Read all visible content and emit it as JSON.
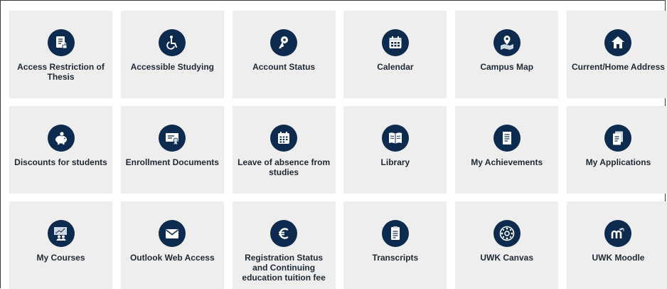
{
  "tiles": [
    {
      "label": "Access Restriction of Thesis",
      "icon": "document-lock-icon"
    },
    {
      "label": "Accessible Studying",
      "icon": "wheelchair-icon"
    },
    {
      "label": "Account Status",
      "icon": "key-icon"
    },
    {
      "label": "Calendar",
      "icon": "calendar-icon"
    },
    {
      "label": "Campus Map",
      "icon": "map-pin-icon"
    },
    {
      "label": "Current/Home Address",
      "icon": "home-icon"
    },
    {
      "label": "Discounts for students",
      "icon": "piggy-bank-icon"
    },
    {
      "label": "Enrollment Documents",
      "icon": "certificate-icon"
    },
    {
      "label": "Leave of absence from studies",
      "icon": "calendar-grid-icon"
    },
    {
      "label": "Library",
      "icon": "book-icon"
    },
    {
      "label": "My Achievements",
      "icon": "document-list-icon"
    },
    {
      "label": "My Applications",
      "icon": "document-stack-icon"
    },
    {
      "label": "My Courses",
      "icon": "presentation-group-icon"
    },
    {
      "label": "Outlook Web Access",
      "icon": "envelope-icon"
    },
    {
      "label": "Registration Status and Continuing education tuition fee",
      "icon": "euro-icon"
    },
    {
      "label": "Transcripts",
      "icon": "transcript-icon"
    },
    {
      "label": "UWK Canvas",
      "icon": "canvas-logo-icon"
    },
    {
      "label": "UWK Moodle",
      "icon": "moodle-logo-icon"
    }
  ],
  "colors": {
    "icon_bg": "#0d2a4f",
    "tile_bg": "#eeeeee",
    "label_text": "#1f2933"
  }
}
